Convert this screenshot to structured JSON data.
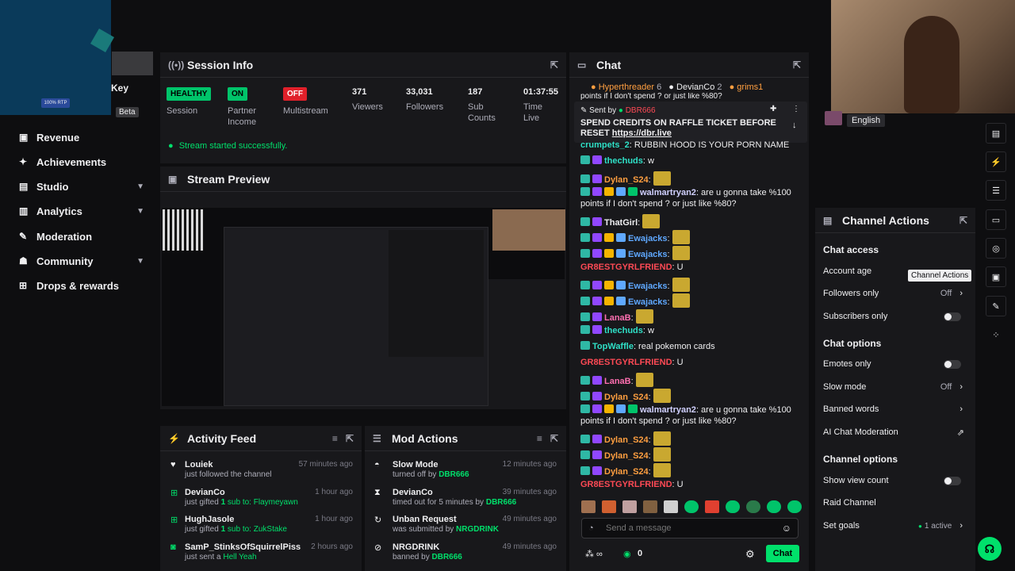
{
  "sidebar": {
    "stream_key_label": "Key",
    "beta_badge": "Beta",
    "rtp_badge": "100% RTP",
    "items": [
      {
        "label": "Revenue",
        "icon": "dollar-icon",
        "glyph": "▣",
        "chevron": ""
      },
      {
        "label": "Achievements",
        "icon": "trophy-icon",
        "glyph": "✦",
        "chevron": ""
      },
      {
        "label": "Studio",
        "icon": "studio-icon",
        "glyph": "▤",
        "chevron": "▼"
      },
      {
        "label": "Analytics",
        "icon": "analytics-icon",
        "glyph": "▥",
        "chevron": "▼"
      },
      {
        "label": "Moderation",
        "icon": "wrench-icon",
        "glyph": "✎",
        "chevron": ""
      },
      {
        "label": "Community",
        "icon": "people-icon",
        "glyph": "☗",
        "chevron": "▼"
      },
      {
        "label": "Drops & rewards",
        "icon": "gift-icon",
        "glyph": "⊞",
        "chevron": ""
      }
    ]
  },
  "session": {
    "title": "Session Info",
    "health": {
      "value": "HEALTHY",
      "label": "Session"
    },
    "partner": {
      "value": "ON",
      "label1": "Partner",
      "label2": "Income"
    },
    "multistream": {
      "value": "OFF",
      "label": "Multistream"
    },
    "viewers": {
      "value": "371",
      "label": "Viewers"
    },
    "followers": {
      "value": "33,031",
      "label": "Followers"
    },
    "subs": {
      "value": "187",
      "label1": "Sub",
      "label2": "Counts"
    },
    "time": {
      "value": "01:37:55",
      "label1": "Time",
      "label2": "Live"
    },
    "status_message": "Stream started successfully."
  },
  "preview": {
    "title": "Stream Preview"
  },
  "activity": {
    "title": "Activity Feed",
    "rows": [
      {
        "name": "Louiek",
        "sub_a": "just followed the channel",
        "sub_b": "",
        "sub_c": "",
        "time": "57 minutes ago",
        "icon": "heart-icon",
        "glyph": "♥"
      },
      {
        "name": "DevianCo",
        "sub_a": "just gifted ",
        "sub_b": "1",
        "sub_c": " sub to: Flaymeyawn",
        "time": "1 hour ago",
        "icon": "gift-icon",
        "glyph": "⊞"
      },
      {
        "name": "HughJasole",
        "sub_a": "just gifted ",
        "sub_b": "1",
        "sub_c": " sub to: ZukStake",
        "time": "1 hour ago",
        "icon": "gift-icon",
        "glyph": "⊞"
      },
      {
        "name": "SamP_StinksOfSquirrelPiss",
        "sub_a": "just sent a ",
        "sub_b": "",
        "sub_c": "Hell Yeah",
        "time": "2 hours ago",
        "icon": "kick-icon",
        "glyph": "◙"
      }
    ]
  },
  "mod": {
    "title": "Mod Actions",
    "rows": [
      {
        "name": "Slow Mode",
        "sub": "turned off by ",
        "by": "DBR666",
        "time": "12 minutes ago",
        "icon": "slow-icon",
        "glyph": "◓"
      },
      {
        "name": "DevianCo",
        "sub": "timed out for 5 minutes by ",
        "by": "DBR666",
        "time": "39 minutes ago",
        "icon": "hourglass-icon",
        "glyph": "⧗"
      },
      {
        "name": "Unban Request",
        "sub": "was submitted by ",
        "by": "NRGDRINK",
        "time": "49 minutes ago",
        "icon": "refresh-icon",
        "glyph": "↻"
      },
      {
        "name": "NRGDRINK",
        "sub": "banned by ",
        "by": "DBR666",
        "time": "49 minutes ago",
        "icon": "ban-icon",
        "glyph": "⊘"
      }
    ]
  },
  "chat": {
    "title": "Chat",
    "top_gifters": [
      {
        "name": "Hyperthreader",
        "count": "6"
      },
      {
        "name": "DevianCo",
        "count": "2"
      },
      {
        "name": "grims1",
        "count": ""
      }
    ],
    "overflow_text": "points if I don't spend ? or just like %80?",
    "pinned": {
      "sent_by": "Sent by",
      "author": "DBR666",
      "text": "SPEND CREDITS ON RAFFLE TICKET BEFORE RESET",
      "link": "https://dbr.live"
    },
    "messages": [
      {
        "user": "crumpets_2",
        "text": ": RUBBIN HOOD IS YOUR PORN NAME",
        "color": "#2fe0c7",
        "badges": 0,
        "emote": false
      },
      {
        "user": "thechuds",
        "text": ": w",
        "color": "#2fe0c7",
        "badges": 2,
        "emote": false
      },
      {
        "user": "Dylan_S24",
        "text": ":",
        "color": "#ff9f40",
        "badges": 2,
        "emote": true
      },
      {
        "user": "walmartryan2",
        "text": ": are u gonna take %100 points if I don't spend ? or just like %80?",
        "color": "#d1d1ff",
        "badges": 5,
        "emote": false
      },
      {
        "user": "ThatGirl",
        "text": ":",
        "color": "#efeff1",
        "badges": 2,
        "emote": true
      },
      {
        "user": "Ewajacks",
        "text": ":",
        "color": "#5fa8ff",
        "badges": 4,
        "emote": true
      },
      {
        "user": "Ewajacks",
        "text": ":",
        "color": "#5fa8ff",
        "badges": 4,
        "emote": true
      },
      {
        "user": "GR8ESTGYRLFRIEND",
        "text": ": U",
        "color": "#ff4a55",
        "badges": 0,
        "emote": false
      },
      {
        "user": "Ewajacks",
        "text": ":",
        "color": "#5fa8ff",
        "badges": 4,
        "emote": true
      },
      {
        "user": "Ewajacks",
        "text": ":",
        "color": "#5fa8ff",
        "badges": 4,
        "emote": true
      },
      {
        "user": "LanaB",
        "text": ":",
        "color": "#ff6fb0",
        "badges": 2,
        "emote": true
      },
      {
        "user": "thechuds",
        "text": ": w",
        "color": "#2fe0c7",
        "badges": 2,
        "emote": false
      },
      {
        "user": "TopWaffle",
        "text": ": real pokemon cards",
        "color": "#2fe0c7",
        "badges": 1,
        "emote": false
      },
      {
        "user": "GR8ESTGYRLFRIEND",
        "text": ": U",
        "color": "#ff4a55",
        "badges": 0,
        "emote": false
      },
      {
        "user": "LanaB",
        "text": ":",
        "color": "#ff6fb0",
        "badges": 2,
        "emote": true
      },
      {
        "user": "Dylan_S24",
        "text": ":",
        "color": "#ff9f40",
        "badges": 2,
        "emote": true
      },
      {
        "user": "walmartryan2",
        "text": ": are u gonna take %100 points if I don't spend ? or just like %80?",
        "color": "#d1d1ff",
        "badges": 5,
        "emote": false
      },
      {
        "user": "Dylan_S24",
        "text": ":",
        "color": "#ff9f40",
        "badges": 2,
        "emote": true
      },
      {
        "user": "Dylan_S24",
        "text": ":",
        "color": "#ff9f40",
        "badges": 2,
        "emote": true
      },
      {
        "user": "Dylan_S24",
        "text": ":",
        "color": "#ff9f40",
        "badges": 2,
        "emote": true
      },
      {
        "user": "GR8ESTGYRLFRIEND",
        "text": ": U",
        "color": "#ff4a55",
        "badges": 0,
        "emote": false
      }
    ],
    "input_placeholder": "Send a message",
    "points": "0",
    "send_label": "Chat"
  },
  "webcam": {
    "language": "English"
  },
  "channel_actions": {
    "title": "Channel Actions",
    "tooltip": "Channel Actions",
    "sections": {
      "chat_access": "Chat access",
      "chat_options": "Chat options",
      "channel_options": "Channel options"
    },
    "account_age": "Account age",
    "followers_only": "Followers only",
    "followers_only_value": "Off",
    "subscribers_only": "Subscribers only",
    "emotes_only": "Emotes only",
    "slow_mode": "Slow mode",
    "slow_mode_value": "Off",
    "banned_words": "Banned words",
    "ai_moderation": "AI Chat Moderation",
    "show_view_count": "Show view count",
    "raid_channel": "Raid Channel",
    "set_goals": "Set goals",
    "goals_value": "1 active"
  },
  "colors": {
    "accent": "#00e06b",
    "panel": "#18181b",
    "bg": "#0e0e10"
  }
}
